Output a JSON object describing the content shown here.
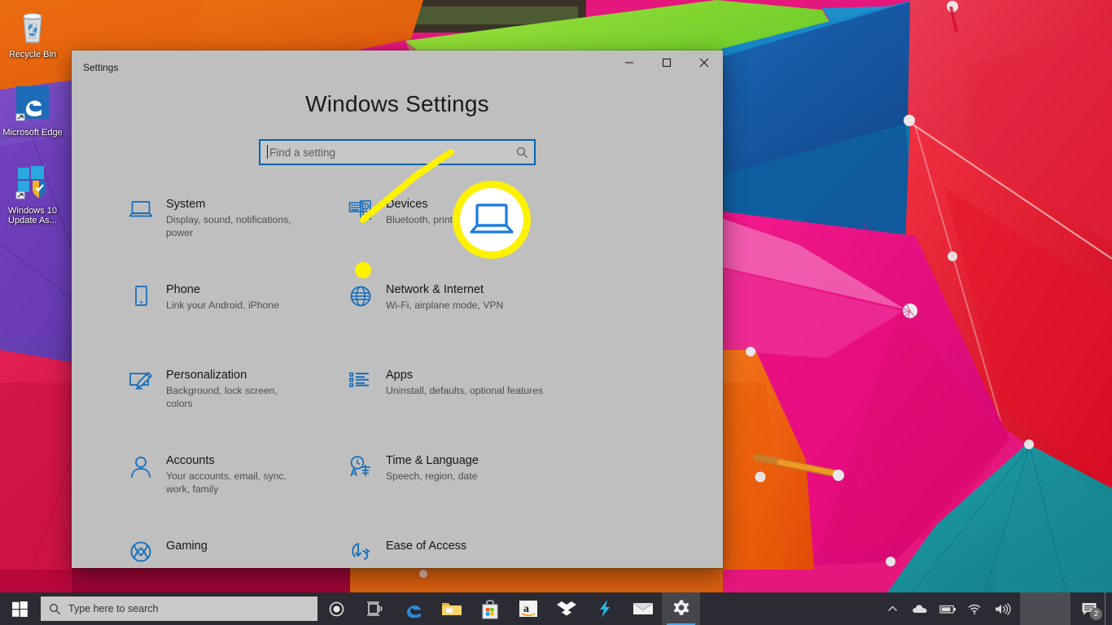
{
  "desktop": {
    "icons": [
      {
        "name": "recycle-bin",
        "label": "Recycle Bin",
        "icon": "recycle-bin-icon"
      },
      {
        "name": "microsoft-edge",
        "label": "Microsoft Edge",
        "icon": "edge-icon"
      },
      {
        "name": "windows-10-update-assistant",
        "label": "Windows 10 Update As...",
        "icon": "windows-update-icon"
      }
    ],
    "wallpaper_description": "Colorful umbrellas",
    "wallpaper_colors": [
      "#e8650d",
      "#6ec92b",
      "#1585c4",
      "#1a4fa0",
      "#e8204b",
      "#e5177d",
      "#6b3fb5",
      "#17909c"
    ]
  },
  "window": {
    "title": "Settings",
    "heading": "Windows Settings",
    "controls": {
      "minimize": "minimize-icon",
      "maximize": "maximize-icon",
      "close": "close-icon"
    }
  },
  "search": {
    "placeholder": "Find a setting",
    "value": "",
    "icon": "search-icon"
  },
  "categories": [
    {
      "id": "system",
      "title": "System",
      "subtitle": "Display, sound, notifications, power",
      "icon": "laptop-icon"
    },
    {
      "id": "devices",
      "title": "Devices",
      "subtitle": "Bluetooth, printers, mouse",
      "icon": "devices-icon"
    },
    {
      "id": "phone",
      "title": "Phone",
      "subtitle": "Link your Android, iPhone",
      "icon": "phone-icon"
    },
    {
      "id": "network-internet",
      "title": "Network & Internet",
      "subtitle": "Wi-Fi, airplane mode, VPN",
      "icon": "globe-icon"
    },
    {
      "id": "personalization",
      "title": "Personalization",
      "subtitle": "Background, lock screen, colors",
      "icon": "personalization-icon"
    },
    {
      "id": "apps",
      "title": "Apps",
      "subtitle": "Uninstall, defaults, optional features",
      "icon": "apps-list-icon"
    },
    {
      "id": "accounts",
      "title": "Accounts",
      "subtitle": "Your accounts, email, sync, work, family",
      "icon": "person-icon"
    },
    {
      "id": "time-language",
      "title": "Time & Language",
      "subtitle": "Speech, region, date",
      "icon": "clock-language-icon"
    },
    {
      "id": "gaming",
      "title": "Gaming",
      "subtitle": "",
      "icon": "xbox-icon"
    },
    {
      "id": "ease-of-access",
      "title": "Ease of Access",
      "subtitle": "",
      "icon": "ease-of-access-icon"
    }
  ],
  "callout": {
    "target": "system",
    "magnified_icon": "laptop-icon",
    "color": "#fff200"
  },
  "taskbar": {
    "start": "windows-logo-icon",
    "search_placeholder": "Type here to search",
    "search_icon": "search-icon",
    "buttons": [
      {
        "name": "cortana",
        "icon": "cortana-circle-icon",
        "active": false
      },
      {
        "name": "task-view",
        "icon": "task-view-icon",
        "active": false
      },
      {
        "name": "microsoft-edge",
        "icon": "edge-icon",
        "active": false
      },
      {
        "name": "file-explorer",
        "icon": "folder-icon",
        "active": false
      },
      {
        "name": "microsoft-store",
        "icon": "store-bag-icon",
        "active": false
      },
      {
        "name": "amazon",
        "icon": "amazon-icon",
        "active": false
      },
      {
        "name": "dropbox",
        "icon": "dropbox-icon",
        "active": false
      },
      {
        "name": "lightning-app",
        "icon": "lightning-bolt-icon",
        "active": false
      },
      {
        "name": "mail",
        "icon": "envelope-icon",
        "active": false
      },
      {
        "name": "settings",
        "icon": "gear-icon",
        "active": true
      }
    ],
    "tray": [
      {
        "name": "show-hidden-icons",
        "icon": "chevron-up-icon"
      },
      {
        "name": "onedrive",
        "icon": "cloud-icon"
      },
      {
        "name": "battery",
        "icon": "battery-icon"
      },
      {
        "name": "network",
        "icon": "wifi-icon"
      },
      {
        "name": "volume",
        "icon": "speaker-icon"
      }
    ],
    "notification_count": "2",
    "notification_icon": "notification-icon"
  }
}
